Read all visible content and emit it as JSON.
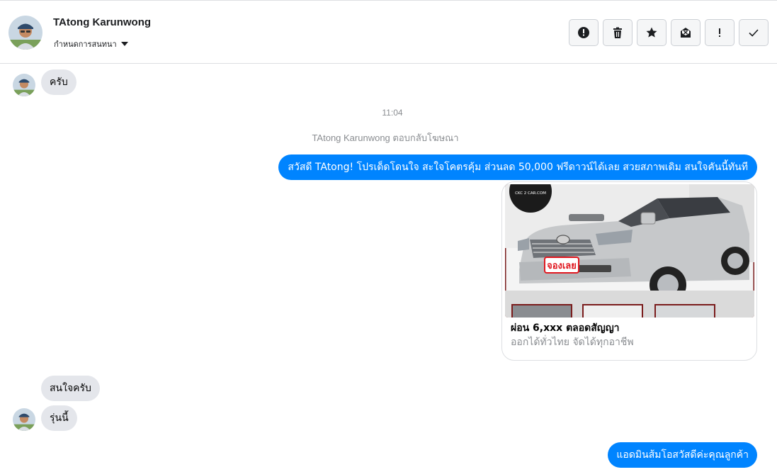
{
  "header": {
    "contact_name": "TAtong Karunwong",
    "conversation_settings": "กำหนดการสนทนา",
    "actions": [
      {
        "name": "report-spam-button",
        "icon": "alert-circle-icon"
      },
      {
        "name": "delete-button",
        "icon": "trash-icon"
      },
      {
        "name": "star-button",
        "icon": "star-icon"
      },
      {
        "name": "mark-unread-button",
        "icon": "envelope-x-icon"
      },
      {
        "name": "mark-important-button",
        "icon": "exclamation-icon"
      },
      {
        "name": "mark-done-button",
        "icon": "checkmark-icon"
      }
    ]
  },
  "messages": {
    "m1": "ครับ",
    "timestamp": "11:04",
    "ad_reply_note": "TAtong Karunwong ตอบกลับโฆษณา",
    "m2": "สวัสดี TAtong! โปรเด็ดโดนใจ สะใจโคตรคุ้ม ส่วนลด 50,000 ฟรีดาวน์ได้เลย สวยสภาพเดิม สนใจคันนี้ทันที",
    "m3": "สนใจครับ",
    "m4": "รุ่นนี้",
    "m5": "แอดมินส้มโอสวัสดีค่ะคุณลูกค้า"
  },
  "ad_card": {
    "title": "ผ่อน 6,xxx ตลอดสัญญา",
    "subtitle": "ออกได้ทั่วไทย จัดได้ทุกอาชีพ",
    "badge_text": "จองเลย",
    "logo_text": "CKC 2 CAR.COM"
  },
  "colors": {
    "outgoing_bubble": "#0084ff",
    "incoming_bubble": "#e4e6eb",
    "badge_red": "#e0171f"
  }
}
